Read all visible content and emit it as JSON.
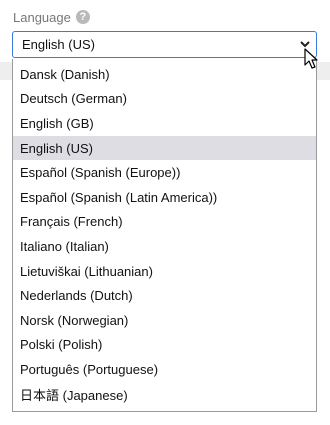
{
  "field": {
    "label": "Language",
    "help_icon": "help-icon",
    "selected_value": "English (US)"
  },
  "dropdown": {
    "options": [
      {
        "label": "Dansk (Danish)",
        "selected": false
      },
      {
        "label": "Deutsch (German)",
        "selected": false
      },
      {
        "label": "English (GB)",
        "selected": false
      },
      {
        "label": "English (US)",
        "selected": true
      },
      {
        "label": "Español (Spanish (Europe))",
        "selected": false
      },
      {
        "label": "Español (Spanish (Latin America))",
        "selected": false
      },
      {
        "label": "Français (French)",
        "selected": false
      },
      {
        "label": "Italiano (Italian)",
        "selected": false
      },
      {
        "label": "Lietuviškai (Lithuanian)",
        "selected": false
      },
      {
        "label": "Nederlands (Dutch)",
        "selected": false
      },
      {
        "label": "Norsk (Norwegian)",
        "selected": false
      },
      {
        "label": "Polski (Polish)",
        "selected": false
      },
      {
        "label": "Português (Portuguese)",
        "selected": false
      },
      {
        "label": "日本語 (Japanese)",
        "selected": false
      }
    ]
  },
  "colors": {
    "focus_border": "#3a7bd5",
    "highlight": "#dedde3",
    "label_text": "#777777"
  }
}
